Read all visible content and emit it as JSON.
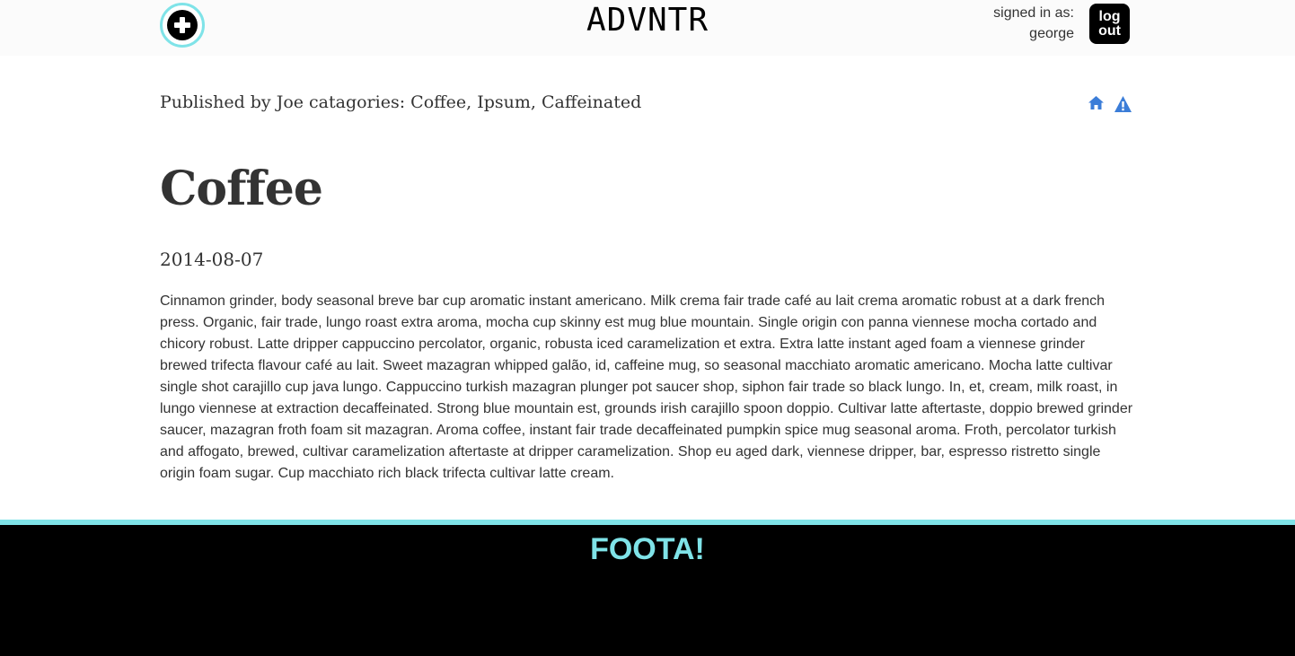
{
  "header": {
    "brand": "ADVNTR",
    "add_icon": "plus-circle-icon",
    "signed_in_label": "signed in as:",
    "username": "george",
    "logout_line1": "log",
    "logout_line2": "out"
  },
  "post": {
    "published_by": "Published by Joe",
    "categories_label": "catagories:",
    "categories": "Coffee, Ipsum, Caffeinated",
    "title": "Coffee",
    "date": "2014-08-07",
    "body": "Cinnamon grinder, body seasonal breve bar cup aromatic instant americano. Milk crema fair trade café au lait crema aromatic robust at a dark french press. Organic, fair trade, lungo roast extra aroma, mocha cup skinny est mug blue mountain. Single origin con panna viennese mocha cortado and chicory robust. Latte dripper cappuccino percolator, organic, robusta iced caramelization et extra. Extra latte instant aged foam a viennese grinder brewed trifecta flavour café au lait. Sweet mazagran whipped galão, id, caffeine mug, so seasonal macchiato aromatic americano. Mocha latte cultivar single shot carajillo cup java lungo. Cappuccino turkish mazagran plunger pot saucer shop, siphon fair trade so black lungo. In, et, cream, milk roast, in lungo viennese at extraction decaffeinated. Strong blue mountain est, grounds irish carajillo spoon doppio. Cultivar latte aftertaste, doppio brewed grinder saucer, mazagran froth foam sit mazagran. Aroma coffee, instant fair trade decaffeinated pumpkin spice mug seasonal aroma. Froth, percolator turkish and affogato, brewed, cultivar caramelization aftertaste at dripper caramelization. Shop eu aged dark, viennese dripper, bar, espresso ristretto single origin foam sugar. Cup macchiato rich black trifecta cultivar latte cream."
  },
  "tools": {
    "home_icon": "home-icon",
    "report_icon": "warning-icon"
  },
  "footer": {
    "title": "FOOTA!"
  },
  "colors": {
    "accent": "#7fe3e8",
    "icon_blue": "#3b7dd8",
    "text": "#333333",
    "footer_bg": "#000000"
  }
}
